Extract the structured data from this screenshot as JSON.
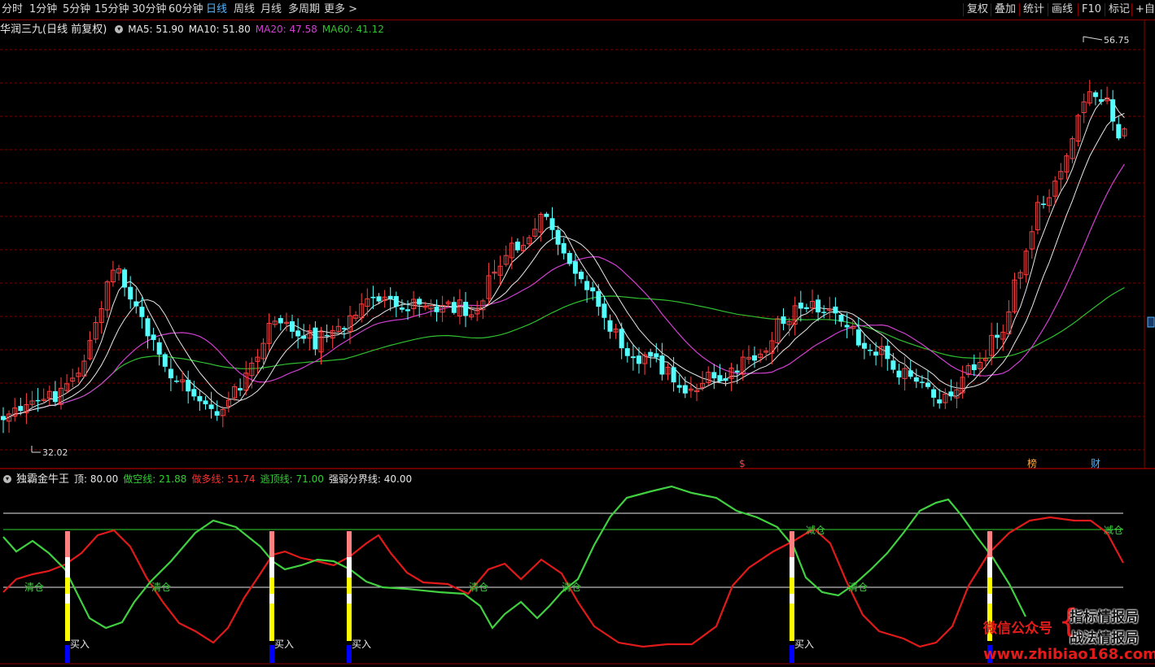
{
  "toolbar": {
    "periods": [
      "分时",
      "1分钟",
      "5分钟",
      "15分钟",
      "30分钟",
      "60分钟",
      "日线",
      "周线",
      "月线",
      "多周期",
      "更多 >"
    ],
    "active_period": "日线",
    "right_buttons": [
      "复权",
      "叠加",
      "统计",
      "画线",
      "F10",
      "标记",
      "+自选"
    ]
  },
  "main_chart": {
    "stock_title": "华润三九(日线 前复权)",
    "ma_labels": [
      {
        "text": "MA5: 51.90",
        "color": "#e8e8e8"
      },
      {
        "text": "MA10: 51.80",
        "color": "#e8e8e8"
      },
      {
        "text": "MA20: 47.58",
        "color": "#d040d0"
      },
      {
        "text": "MA60: 41.12",
        "color": "#30c030"
      }
    ],
    "high_label": "56.75",
    "low_label": "32.02",
    "markers": [
      "$",
      "榜",
      "财"
    ]
  },
  "indicator": {
    "name": "独霸金牛王",
    "values": [
      {
        "text": "顶: 80.00",
        "color": "#e8e8e8"
      },
      {
        "text": "做空线: 21.88",
        "color": "#30d030"
      },
      {
        "text": "做多线: 51.74",
        "color": "#ff3030"
      },
      {
        "text": "逃顶线: 71.00",
        "color": "#30d030"
      },
      {
        "text": "强弱分界线: 40.00",
        "color": "#e8e8e8"
      }
    ],
    "signal_qingcang": "清仓",
    "signal_jiancang": "减仓",
    "signal_buy": "买入"
  },
  "watermark": {
    "wechat": "微信公众号",
    "line1": "指标情报局",
    "line2": "战法情报局",
    "url": "www.zhibiao168.com"
  },
  "colors": {
    "up": "#ff4040",
    "down": "#54ffff",
    "ma5": "#e8e8e8",
    "ma20": "#d040d0",
    "ma60": "#30c030",
    "border": "#8a0000"
  }
}
